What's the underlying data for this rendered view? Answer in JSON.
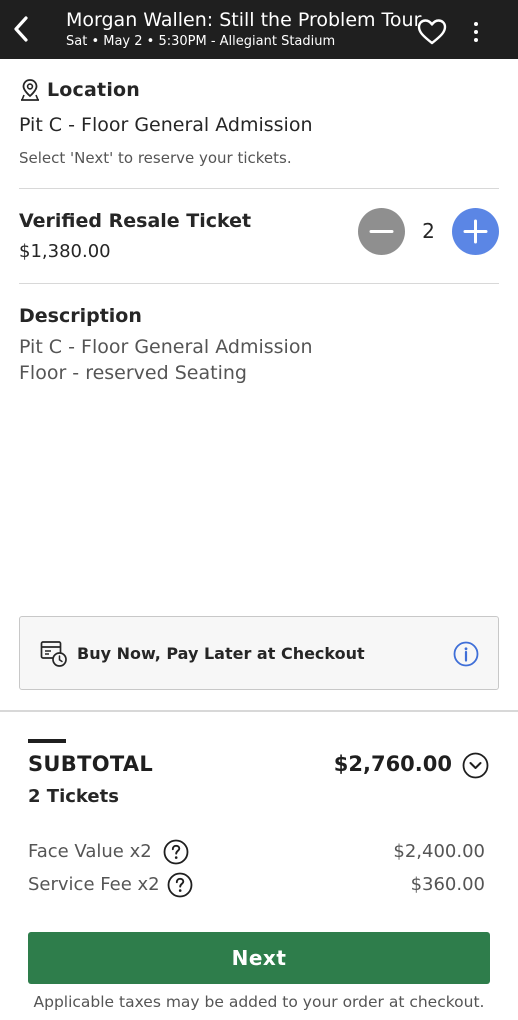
{
  "header": {
    "title": "Morgan Wallen: Still the Problem Tour",
    "subtitle": "Sat • May 2 • 5:30PM - Allegiant Stadium"
  },
  "location": {
    "heading": "Location",
    "name": "Pit C - Floor General Admission",
    "hint": "Select 'Next' to reserve your tickets."
  },
  "ticket": {
    "type": "Verified Resale Ticket",
    "price": "$1,380.00",
    "quantity": "2"
  },
  "description": {
    "heading": "Description",
    "lines": [
      "Pit C - Floor General Admission",
      "Floor - reserved Seating"
    ]
  },
  "bnpl": {
    "text": "Buy Now, Pay Later at Checkout"
  },
  "summary": {
    "label": "SUBTOTAL",
    "total": "$2,760.00",
    "tickets": "2 Tickets",
    "fees": [
      {
        "label": "Face Value x2",
        "value": "$2,400.00"
      },
      {
        "label": "Service Fee x2",
        "value": "$360.00"
      }
    ]
  },
  "actions": {
    "next_label": "Next",
    "tax_note": "Applicable taxes may be added to your order at checkout."
  },
  "colors": {
    "header_bg": "#1f1f1f",
    "accent_blue": "#5b86e5",
    "next_green": "#2e7d4b"
  },
  "icons": {
    "back": "chevron-left-icon",
    "favorite": "heart-icon",
    "more": "kebab-menu-icon",
    "location": "map-pin-icon",
    "bnpl": "receipt-clock-icon",
    "info": "info-icon",
    "expand": "chevron-down-icon",
    "help": "question-icon"
  }
}
